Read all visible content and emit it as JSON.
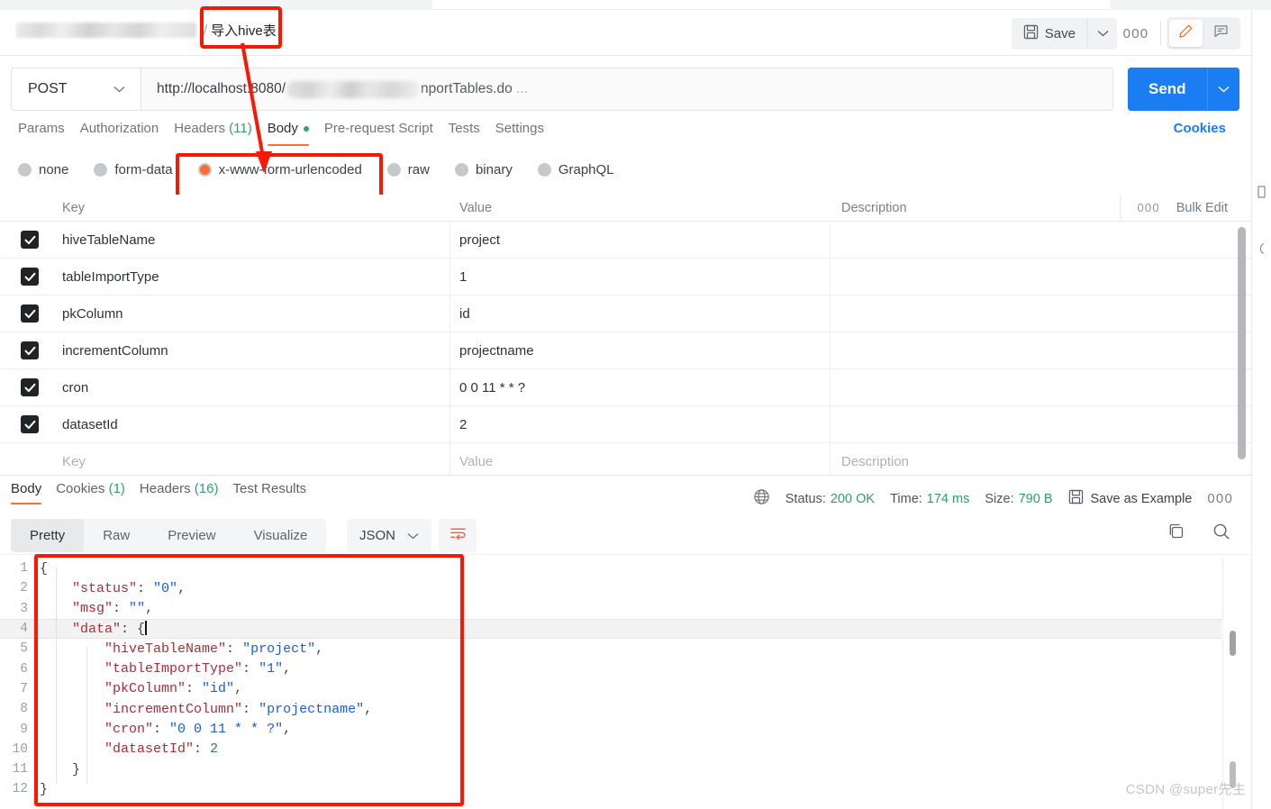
{
  "header": {
    "breadcrumb_blurred": true,
    "breadcrumb_separator": "/",
    "breadcrumb_current": "导入hive表",
    "save_label": "Save",
    "more_dots": "000",
    "save_icon": "floppy-disk-icon",
    "caret_icon": "chevron-down-icon",
    "edit_icon": "pencil-icon",
    "comment_icon": "comment-icon"
  },
  "request": {
    "method": "POST",
    "url_prefix": "http://localhost:8080/",
    "url_suffix": "nportTables.do",
    "url_ellipsis": "...",
    "send_label": "Send",
    "cookies_label": "Cookies"
  },
  "request_tabs": [
    {
      "label": "Params",
      "active": false
    },
    {
      "label": "Authorization",
      "active": false
    },
    {
      "label": "Headers",
      "count": "(11)",
      "active": false
    },
    {
      "label": "Body",
      "active": true,
      "dot": true
    },
    {
      "label": "Pre-request Script",
      "active": false
    },
    {
      "label": "Tests",
      "active": false
    },
    {
      "label": "Settings",
      "active": false
    }
  ],
  "body_types": [
    {
      "label": "none",
      "selected": false
    },
    {
      "label": "form-data",
      "selected": false
    },
    {
      "label": "x-www-form-urlencoded",
      "selected": true
    },
    {
      "label": "raw",
      "selected": false
    },
    {
      "label": "binary",
      "selected": false
    },
    {
      "label": "GraphQL",
      "selected": false
    }
  ],
  "kv_table": {
    "columns": {
      "key": "Key",
      "value": "Value",
      "description": "Description"
    },
    "bulk_edit": "Bulk Edit",
    "bulk_dots": "000",
    "rows": [
      {
        "checked": true,
        "key": "hiveTableName",
        "value": "project",
        "description": ""
      },
      {
        "checked": true,
        "key": "tableImportType",
        "value": "1",
        "description": ""
      },
      {
        "checked": true,
        "key": "pkColumn",
        "value": "id",
        "description": ""
      },
      {
        "checked": true,
        "key": "incrementColumn",
        "value": "projectname",
        "description": ""
      },
      {
        "checked": true,
        "key": "cron",
        "value": "0 0 11 * * ?",
        "description": ""
      },
      {
        "checked": true,
        "key": "datasetId",
        "value": "2",
        "description": ""
      }
    ],
    "placeholder_row": {
      "key": "Key",
      "value": "Value",
      "description": "Description"
    }
  },
  "response": {
    "tabs": [
      {
        "label": "Body",
        "active": true
      },
      {
        "label": "Cookies",
        "count": "(1)",
        "active": false
      },
      {
        "label": "Headers",
        "count": "(16)",
        "active": false
      },
      {
        "label": "Test Results",
        "active": false
      }
    ],
    "status_label": "Status:",
    "status_value": "200 OK",
    "time_label": "Time:",
    "time_value": "174 ms",
    "size_label": "Size:",
    "size_value": "790 B",
    "save_example": "Save as Example",
    "more_dots": "000",
    "globe_icon": "globe-icon",
    "floppy_icon": "floppy-disk-icon",
    "copy_icon": "copy-icon",
    "search_icon": "search-icon",
    "view_tabs": [
      {
        "label": "Pretty",
        "active": true
      },
      {
        "label": "Raw",
        "active": false
      },
      {
        "label": "Preview",
        "active": false
      },
      {
        "label": "Visualize",
        "active": false
      }
    ],
    "format_select": "JSON",
    "wrap_icon": "wrap-lines-icon"
  },
  "json_body": {
    "lines": [
      {
        "n": "1",
        "indent": 0,
        "tokens": [
          {
            "t": "p",
            "v": "{"
          }
        ]
      },
      {
        "n": "2",
        "indent": 1,
        "tokens": [
          {
            "t": "k",
            "v": "\"status\""
          },
          {
            "t": "p",
            "v": ": "
          },
          {
            "t": "s",
            "v": "\"0\""
          },
          {
            "t": "p",
            "v": ","
          }
        ]
      },
      {
        "n": "3",
        "indent": 1,
        "tokens": [
          {
            "t": "k",
            "v": "\"msg\""
          },
          {
            "t": "p",
            "v": ": "
          },
          {
            "t": "s",
            "v": "\"\""
          },
          {
            "t": "p",
            "v": ","
          }
        ]
      },
      {
        "n": "4",
        "indent": 1,
        "highlight": true,
        "cursor": true,
        "tokens": [
          {
            "t": "k",
            "v": "\"data\""
          },
          {
            "t": "p",
            "v": ": "
          },
          {
            "t": "p",
            "v": "{"
          }
        ]
      },
      {
        "n": "5",
        "indent": 2,
        "tokens": [
          {
            "t": "k",
            "v": "\"hiveTableName\""
          },
          {
            "t": "p",
            "v": ": "
          },
          {
            "t": "s",
            "v": "\"project\""
          },
          {
            "t": "p",
            "v": ","
          }
        ]
      },
      {
        "n": "6",
        "indent": 2,
        "tokens": [
          {
            "t": "k",
            "v": "\"tableImportType\""
          },
          {
            "t": "p",
            "v": ": "
          },
          {
            "t": "s",
            "v": "\"1\""
          },
          {
            "t": "p",
            "v": ","
          }
        ]
      },
      {
        "n": "7",
        "indent": 2,
        "tokens": [
          {
            "t": "k",
            "v": "\"pkColumn\""
          },
          {
            "t": "p",
            "v": ": "
          },
          {
            "t": "s",
            "v": "\"id\""
          },
          {
            "t": "p",
            "v": ","
          }
        ]
      },
      {
        "n": "8",
        "indent": 2,
        "tokens": [
          {
            "t": "k",
            "v": "\"incrementColumn\""
          },
          {
            "t": "p",
            "v": ": "
          },
          {
            "t": "s",
            "v": "\"projectname\""
          },
          {
            "t": "p",
            "v": ","
          }
        ]
      },
      {
        "n": "9",
        "indent": 2,
        "tokens": [
          {
            "t": "k",
            "v": "\"cron\""
          },
          {
            "t": "p",
            "v": ": "
          },
          {
            "t": "s",
            "v": "\"0 0 11 * * ?\""
          },
          {
            "t": "p",
            "v": ","
          }
        ]
      },
      {
        "n": "10",
        "indent": 2,
        "tokens": [
          {
            "t": "k",
            "v": "\"datasetId\""
          },
          {
            "t": "p",
            "v": ": "
          },
          {
            "t": "n",
            "v": "2"
          }
        ]
      },
      {
        "n": "11",
        "indent": 1,
        "tokens": [
          {
            "t": "p",
            "v": "}"
          }
        ]
      },
      {
        "n": "12",
        "indent": 0,
        "tokens": [
          {
            "t": "p",
            "v": "}"
          }
        ]
      }
    ]
  },
  "annotations": {
    "color": "#fc1703",
    "boxes": [
      "breadcrumb-current",
      "x-www-form-urlencoded-option",
      "json-response-body"
    ],
    "arrow": "breadcrumb-to-urlencoded"
  },
  "watermark": "CSDN @super先生"
}
